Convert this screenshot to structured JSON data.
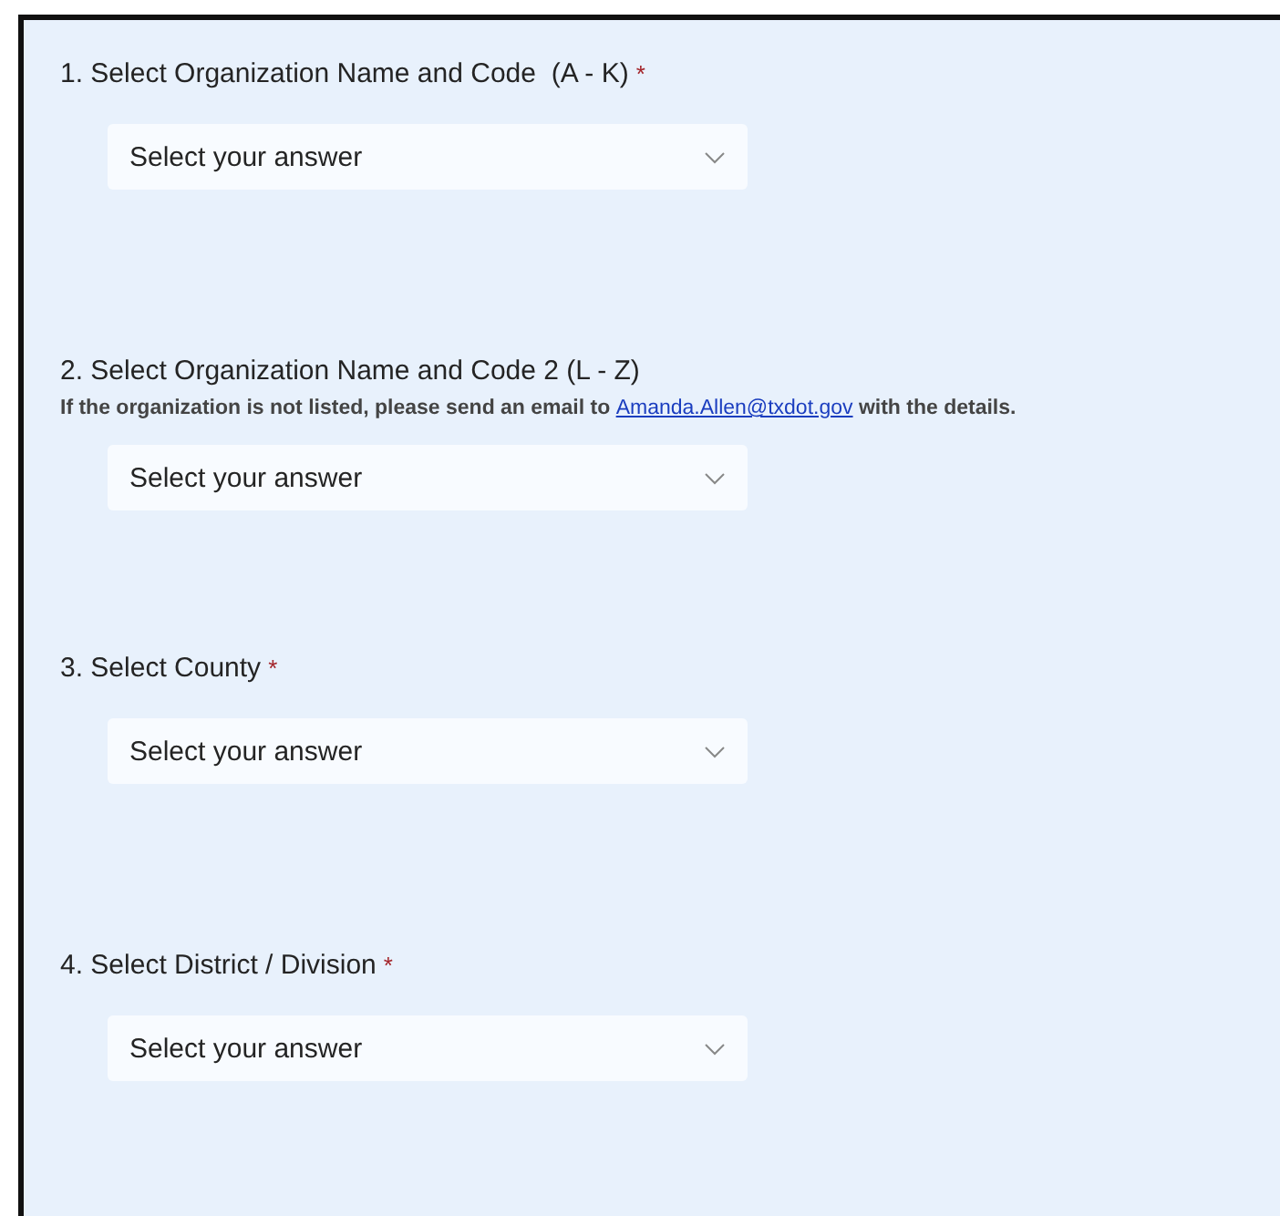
{
  "questions": [
    {
      "title": "1. Select Organization Name and Code  (A - K)",
      "required_mark": "*",
      "dropdown": {
        "placeholder": "Select your answer"
      }
    },
    {
      "title": "2. Select Organization Name and Code 2 (L - Z)",
      "note": {
        "before": "If the organization is not listed, please send an email to",
        "link": "Amanda.Allen@txdot.gov",
        "after": "with the details."
      },
      "dropdown": {
        "placeholder": "Select your answer"
      }
    },
    {
      "title": "3. Select County",
      "required_mark": "*",
      "dropdown": {
        "placeholder": "Select your answer"
      }
    },
    {
      "title": "4. Select District / Division",
      "required_mark": "*",
      "dropdown": {
        "placeholder": "Select your answer"
      }
    }
  ]
}
